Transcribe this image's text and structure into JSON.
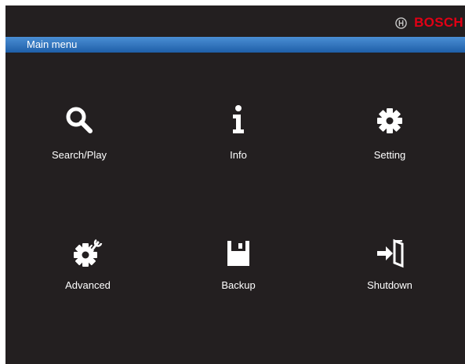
{
  "brand": {
    "name": "BOSCH",
    "color": "#e20015",
    "logo_icon": "bosch-armature-icon"
  },
  "menubar": {
    "title": "Main menu",
    "accent": "#2f74c0"
  },
  "menu_items": [
    {
      "label": "Search/Play",
      "icon": "search-icon"
    },
    {
      "label": "Info",
      "icon": "info-icon"
    },
    {
      "label": "Setting",
      "icon": "gear-icon"
    },
    {
      "label": "Advanced",
      "icon": "gear-wrench-icon"
    },
    {
      "label": "Backup",
      "icon": "floppy-disk-icon"
    },
    {
      "label": "Shutdown",
      "icon": "exit-door-icon"
    }
  ],
  "colors": {
    "background": "#231f20",
    "text": "#ffffff"
  }
}
